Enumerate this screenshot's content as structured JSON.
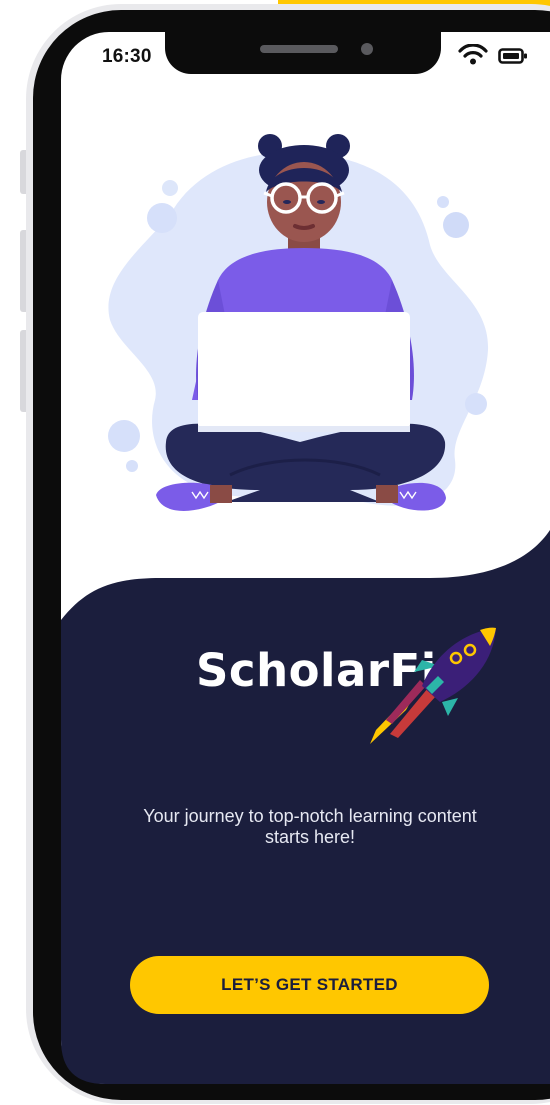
{
  "status_bar": {
    "time": "16:30",
    "wifi_icon": "wifi-icon",
    "battery_icon": "battery-icon"
  },
  "brand": {
    "name": "ScholarFi",
    "logo_icon": "rocket-icon"
  },
  "onboarding": {
    "illustration": "person-with-laptop-illustration",
    "tagline": "Your journey to top-notch learning content starts here!",
    "cta_label": "LET’S GET STARTED"
  },
  "colors": {
    "panel": "#1b1e3d",
    "accent": "#ffc700",
    "blob": "#dfe7fb",
    "shirt": "#7b5ce8",
    "pants": "#252958"
  }
}
